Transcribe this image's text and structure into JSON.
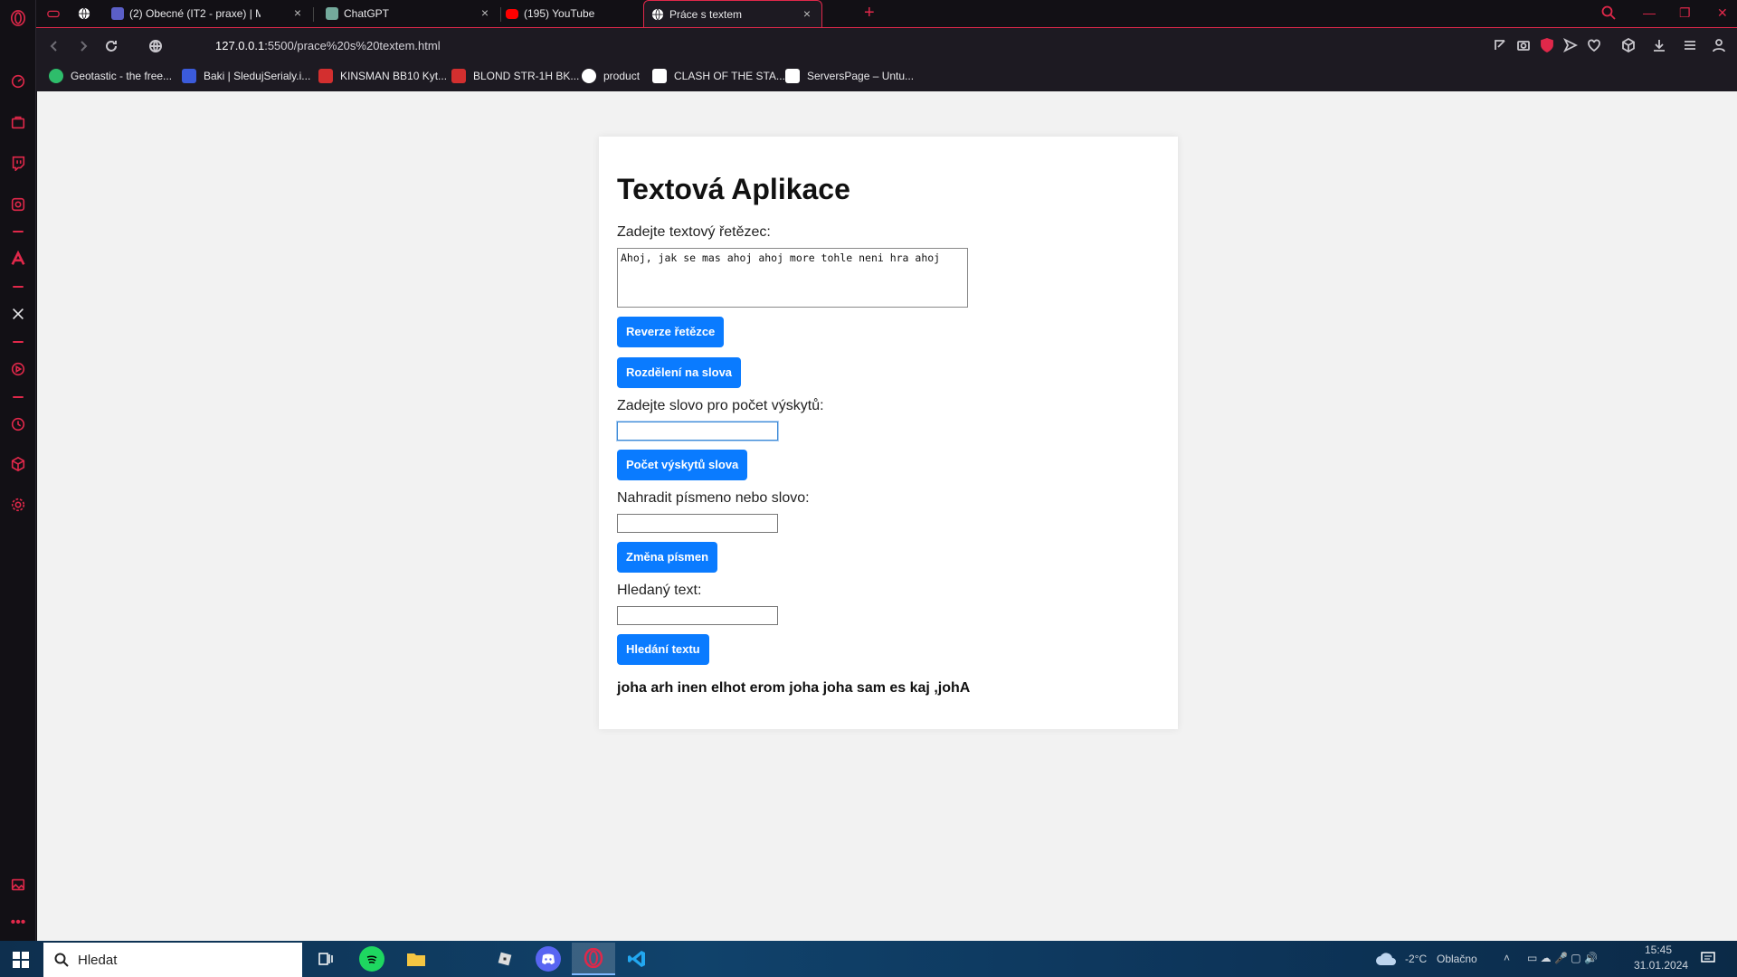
{
  "tabs": [
    {
      "title": "",
      "icon": "game-controller-icon"
    },
    {
      "title": "",
      "icon": "globe-icon"
    },
    {
      "title": "(2) Obecné (IT2 - praxe) | M",
      "icon": "teams-icon"
    },
    {
      "title": "ChatGPT",
      "icon": "chatgpt-icon"
    },
    {
      "title": "(195) YouTube",
      "icon": "youtube-icon"
    },
    {
      "title": "Práce s textem",
      "icon": "globe-icon",
      "active": true
    }
  ],
  "address": {
    "host": "127.0.0.1",
    "path": ":5500/prace%20s%20textem.html"
  },
  "bookmarks": [
    {
      "label": "Geotastic - the free...",
      "color": "#2ebd6b"
    },
    {
      "label": "Baki | SledujSerialy.i...",
      "color": "#3b5bdb"
    },
    {
      "label": "KINSMAN BB10 Kyt...",
      "color": "#d32f2f"
    },
    {
      "label": "BLOND STR-1H BK...",
      "color": "#d32f2f"
    },
    {
      "label": "product",
      "color": "#ffffff"
    },
    {
      "label": "CLASH OF THE STA...",
      "color": "#ffffff"
    },
    {
      "label": "ServersPage – Untu...",
      "color": "#ffffff"
    }
  ],
  "app": {
    "title": "Textová Aplikace",
    "input_label": "Zadejte textový řetězec:",
    "input_value": "Ahoj, jak se mas ahoj ahoj more tohle neni hra ahoj",
    "btn_reverse": "Reverze řetězce",
    "btn_split": "Rozdělení na slova",
    "count_label": "Zadejte slovo pro počet výskytů:",
    "btn_count": "Počet výskytů slova",
    "replace_label": "Nahradit písmeno nebo slovo:",
    "btn_replace": "Změna písmen",
    "search_label": "Hledaný text:",
    "btn_search": "Hledání textu",
    "result": "joha arh inen elhot erom joha joha sam es kaj ,johA"
  },
  "taskbar": {
    "search_placeholder": "Hledat",
    "weather_temp": "-2°C",
    "weather_text": "Oblačno",
    "time": "15:45",
    "date": "31.01.2024"
  },
  "colors": {
    "accent": "#e0284a",
    "button": "#0a7bff"
  }
}
